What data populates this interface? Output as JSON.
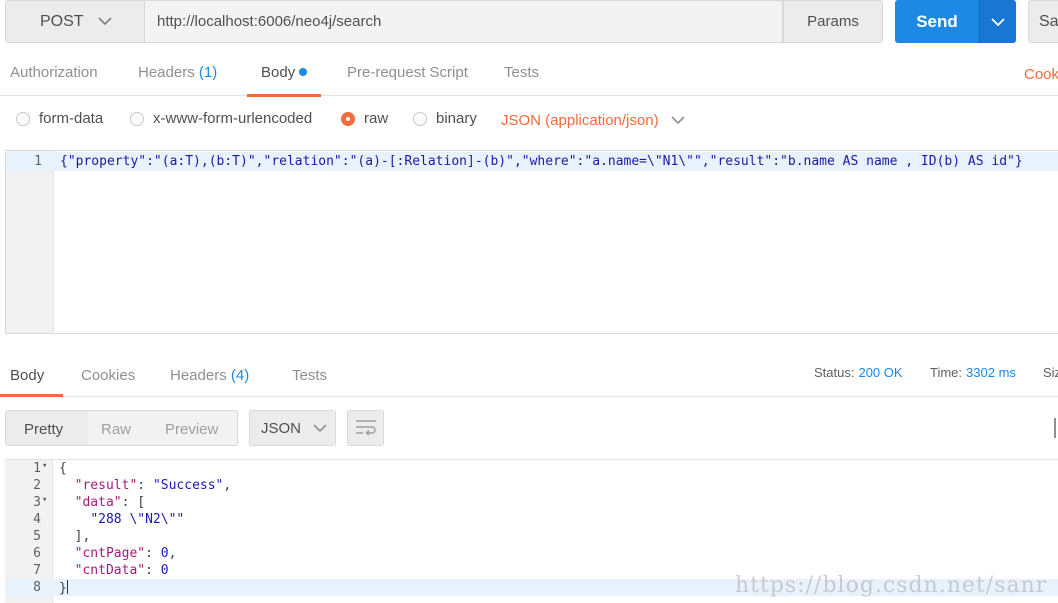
{
  "request": {
    "method": "POST",
    "url": "http://localhost:6006/neo4j/search",
    "params_label": "Params",
    "send_label": "Send",
    "save_label": "Sa"
  },
  "request_tabs": [
    {
      "label": "Authorization"
    },
    {
      "label": "Headers",
      "count": "(1)"
    },
    {
      "label": "Body"
    },
    {
      "label": "Pre-request Script"
    },
    {
      "label": "Tests"
    }
  ],
  "cookies_link": "Cook",
  "body_types": [
    "form-data",
    "x-www-form-urlencoded",
    "raw",
    "binary"
  ],
  "selected_body_type": "raw",
  "content_type": "JSON (application/json)",
  "request_body": {
    "line_number": "1",
    "code": "{\"property\":\"(a:T),(b:T)\",\"relation\":\"(a)-[:Relation]-(b)\",\"where\":\"a.name=\\\"N1\\\"\",\"result\":\"b.name AS name , ID(b) AS id\"}"
  },
  "response_tabs": [
    {
      "label": "Body"
    },
    {
      "label": "Cookies"
    },
    {
      "label": "Headers",
      "count": "(4)"
    },
    {
      "label": "Tests"
    }
  ],
  "status": {
    "status_label": "Status:",
    "status_value": "200 OK",
    "time_label": "Time:",
    "time_value": "3302 ms",
    "size_label": "Siz"
  },
  "view_modes": [
    "Pretty",
    "Raw",
    "Preview"
  ],
  "format": "JSON",
  "response_body": {
    "line_numbers": [
      "1",
      "2",
      "3",
      "4",
      "5",
      "6",
      "7",
      "8"
    ],
    "l1": "{",
    "k_result": "\"result\"",
    "v_result": "\"Success\"",
    "k_data": "\"data\"",
    "v_data_open": "[",
    "v_item": "\"288 \\\"N2\\\"\"",
    "v_data_close": "],",
    "k_cntPage": "\"cntPage\"",
    "v_cntPage": "0",
    "k_cntData": "\"cntData\"",
    "v_cntData": "0",
    "l8": "}"
  },
  "watermark": "https://blog.csdn.net/sanr"
}
